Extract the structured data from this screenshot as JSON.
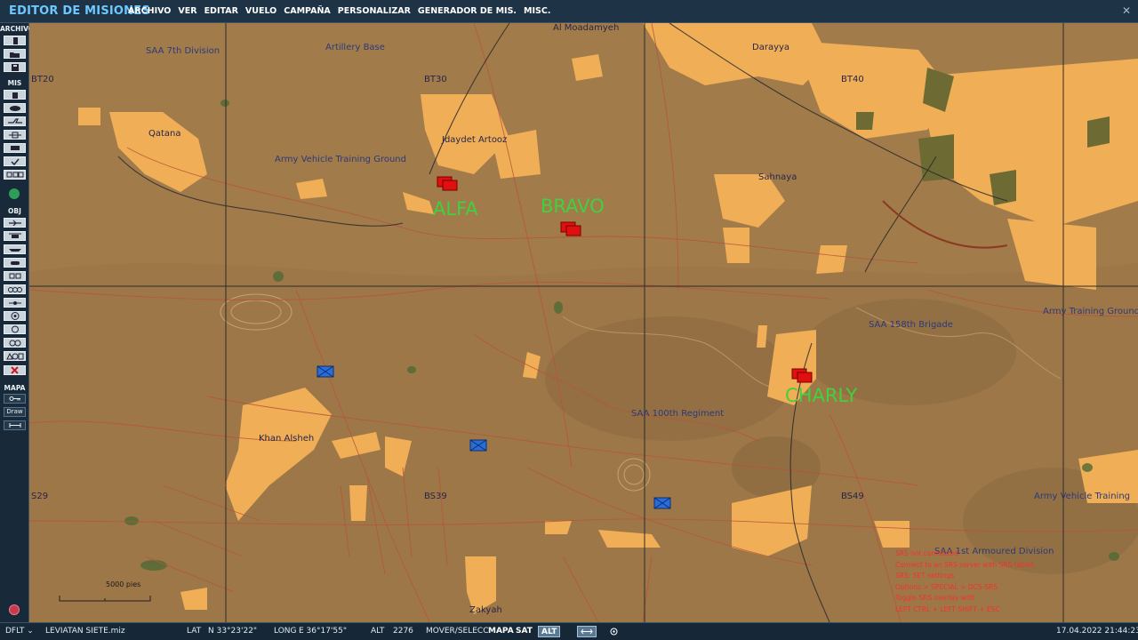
{
  "app": {
    "title": "EDITOR DE MISIONES"
  },
  "menu": [
    "ARCHIVO",
    "VER",
    "EDITAR",
    "VUELO",
    "CAMPAÑA",
    "PERSONALIZAR",
    "GENERADOR DE MIS.",
    "MISC."
  ],
  "sidebar": {
    "archivo": "ARCHIVO",
    "mis": "MIS",
    "obj": "OBJ",
    "mapa": "MAPA",
    "draw": "Draw"
  },
  "map": {
    "grid_labels": [
      "BT20",
      "BT30",
      "BT40",
      "S29",
      "BS39",
      "BS49"
    ],
    "places": [
      "SAA 7th Division",
      "Artillery Base",
      "Al Moadamyeh",
      "Darayya",
      "Qatana",
      "Jdaydet Artooz",
      "Army Vehicle Training Ground",
      "Sahnaya",
      "Army Training Ground",
      "SAA 158th Brigade",
      "SAA 100th Regiment",
      "Khan Alsheh",
      "Army Vehicle Training",
      "SAA 1st Armoured Division",
      "Zakyah"
    ],
    "group_labels": [
      "ALFA",
      "BRAVO",
      "CHARLY"
    ],
    "scale": "5000 pies",
    "srs_lines": [
      "SRS not connected",
      "Connect to an SRS server with SRS tablet.",
      "SRS: SET settings",
      "Options > SPECIAL > DCS-SRS",
      "Toggle SRS overlay with",
      "LEFT CTRL + LEFT SHIFT + ESC"
    ]
  },
  "status": {
    "profile": "DFLT",
    "file": "LEVIATAN SIETE.miz",
    "lat_label": "LAT",
    "lat": "N 33°23'22\"",
    "long_label": "LONG",
    "long": "E 36°17'55\"",
    "alt_label": "ALT",
    "alt": "2276",
    "mode": "MOVER/SELECC",
    "mapa": "MAPA",
    "sat": "SAT",
    "alt_btn": "ALT",
    "datetime": "17.04.2022 21:44:23"
  },
  "colors": {
    "red_unit": "#e01010",
    "blue_unit": "#2a6cd8",
    "group_label": "#3fd13f",
    "town": "#f0ae56",
    "terrain": "#a47c4c"
  }
}
